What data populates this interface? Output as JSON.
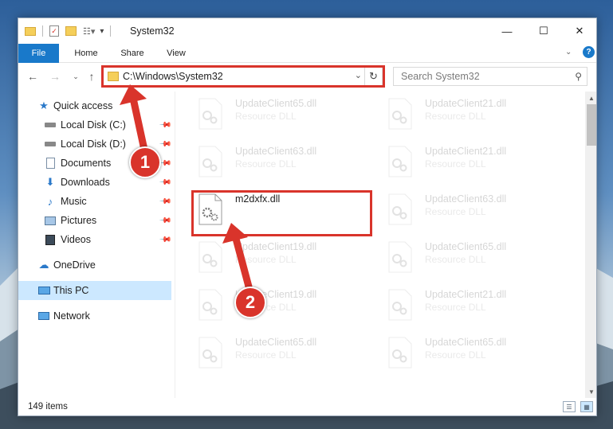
{
  "window": {
    "title": "System32",
    "controls": {
      "minimize": "—",
      "maximize": "☐",
      "close": "✕"
    }
  },
  "ribbon": {
    "tabs": [
      "File",
      "Home",
      "Share",
      "View"
    ]
  },
  "address": {
    "path": "C:\\Windows\\System32",
    "search_placeholder": "Search System32"
  },
  "sidebar": {
    "items": [
      {
        "label": "Quick access",
        "icon": "star-icon"
      },
      {
        "label": "Local Disk (C:)",
        "icon": "drive-icon",
        "pinned": true
      },
      {
        "label": "Local Disk (D:)",
        "icon": "drive-icon",
        "pinned": true
      },
      {
        "label": "Documents",
        "icon": "documents-icon",
        "pinned": true
      },
      {
        "label": "Downloads",
        "icon": "downloads-icon",
        "pinned": true
      },
      {
        "label": "Music",
        "icon": "music-icon",
        "pinned": true
      },
      {
        "label": "Pictures",
        "icon": "pictures-icon",
        "pinned": true
      },
      {
        "label": "Videos",
        "icon": "videos-icon",
        "pinned": true
      },
      {
        "label": "OneDrive",
        "icon": "cloud-icon"
      },
      {
        "label": "This PC",
        "icon": "pc-icon",
        "selected": true
      },
      {
        "label": "Network",
        "icon": "network-icon"
      }
    ]
  },
  "files": {
    "left_col": [
      {
        "name": "UpdateClient65.dll",
        "type": "Resource DLL",
        "faded": true
      },
      {
        "name": "UpdateClient63.dll",
        "type": "Resource DLL",
        "faded": true
      },
      {
        "name": "m2dxfx.dll",
        "type": "",
        "faded": false
      },
      {
        "name": "UpdateClient19.dll",
        "type": "Resource DLL",
        "faded": true
      },
      {
        "name": "UpdateClient19.dll",
        "type": "Resource DLL",
        "faded": true
      },
      {
        "name": "UpdateClient65.dll",
        "type": "Resource DLL",
        "faded": true
      }
    ],
    "right_col": [
      {
        "name": "UpdateClient21.dll",
        "type": "Resource DLL",
        "faded": true
      },
      {
        "name": "UpdateClient21.dll",
        "type": "Resource DLL",
        "faded": true
      },
      {
        "name": "UpdateClient63.dll",
        "type": "Resource DLL",
        "faded": true
      },
      {
        "name": "UpdateClient65.dll",
        "type": "Resource DLL",
        "faded": true
      },
      {
        "name": "UpdateClient21.dll",
        "type": "Resource DLL",
        "faded": true
      },
      {
        "name": "UpdateClient65.dll",
        "type": "Resource DLL",
        "faded": true
      }
    ]
  },
  "status": {
    "item_count": "149 items"
  },
  "annotations": {
    "step1": "1",
    "step2": "2",
    "color": "#d9342b"
  }
}
